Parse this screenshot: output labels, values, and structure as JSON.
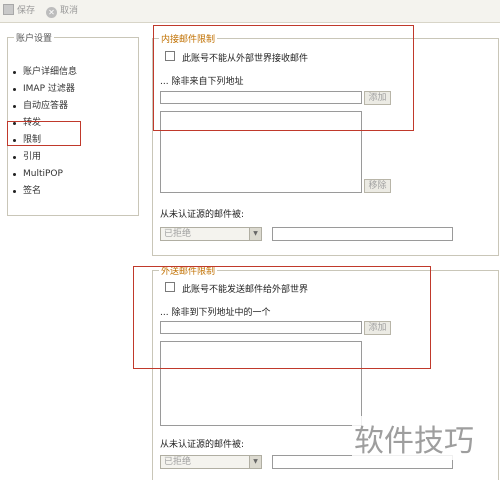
{
  "toolbar": {
    "save_label": "保存",
    "cancel_label": "取消"
  },
  "sidebar": {
    "legend": "账户设置",
    "items": [
      {
        "label": "账户详细信息"
      },
      {
        "label": "IMAP 过滤器"
      },
      {
        "label": "自动应答器"
      },
      {
        "label": "转发"
      },
      {
        "label": "限制"
      },
      {
        "label": "引用"
      },
      {
        "label": "MultiPOP"
      },
      {
        "label": "签名"
      }
    ]
  },
  "inbound": {
    "legend": "内接邮件限制",
    "checkbox_label": "此账号不能从外部世界接收邮件",
    "except_label": "... 除非来自下列地址",
    "address_value": "",
    "add_button": "添加",
    "remove_button": "移除",
    "unauth_label": "从未认证源的邮件被:",
    "unauth_select": "已拒绝",
    "unauth_text": ""
  },
  "outbound": {
    "legend": "外送邮件限制",
    "checkbox_label": "此账号不能发送邮件给外部世界",
    "except_label": "... 除非到下列地址中的一个",
    "address_value": "",
    "add_button": "添加",
    "unauth_label": "从未认证源的邮件被:",
    "unauth_select": "已拒绝",
    "unauth_text": ""
  },
  "watermark": "软件技巧",
  "colors": {
    "highlight": "#c0392b",
    "legend_accent": "#c07000"
  }
}
